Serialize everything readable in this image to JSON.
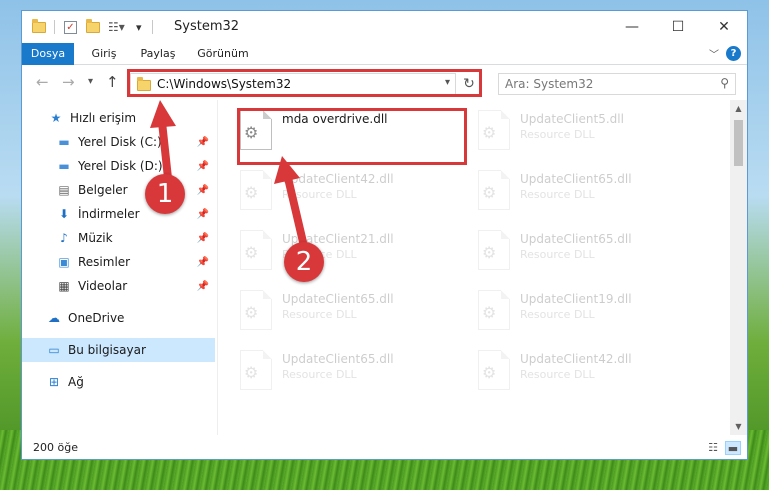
{
  "window": {
    "title": "System32",
    "controls": {
      "minimize": "—",
      "maximize": "☐",
      "close": "✕"
    }
  },
  "ribbon": {
    "tabs": [
      "Dosya",
      "Giriş",
      "Paylaş",
      "Görünüm"
    ],
    "active_tab": "Dosya",
    "help": "?"
  },
  "navigation": {
    "address": "C:\\Windows\\System32",
    "search_placeholder": "Ara: System32"
  },
  "sidebar": {
    "items": [
      {
        "label": "Hızlı erişim",
        "icon": "star-icon"
      },
      {
        "label": "Yerel Disk (C:)",
        "icon": "drive-icon",
        "pinned": true
      },
      {
        "label": "Yerel Disk (D:)",
        "icon": "drive-icon",
        "pinned": true
      },
      {
        "label": "Belgeler",
        "icon": "documents-icon",
        "pinned": true
      },
      {
        "label": "İndirmeler",
        "icon": "download-icon",
        "pinned": true
      },
      {
        "label": "Müzik",
        "icon": "music-icon",
        "pinned": true
      },
      {
        "label": "Resimler",
        "icon": "pictures-icon",
        "pinned": true
      },
      {
        "label": "Videolar",
        "icon": "videos-icon",
        "pinned": true
      },
      {
        "label": "OneDrive",
        "icon": "cloud-icon"
      },
      {
        "label": "Bu bilgisayar",
        "icon": "computer-icon",
        "selected": true
      },
      {
        "label": "Ağ",
        "icon": "network-icon"
      }
    ]
  },
  "files": [
    {
      "name": "mda overdrive.dll",
      "type": "",
      "highlighted": true
    },
    {
      "name": "UpdateClient5.dll",
      "type": "Resource DLL"
    },
    {
      "name": "UpdateClient42.dll",
      "type": "Resource DLL"
    },
    {
      "name": "UpdateClient65.dll",
      "type": "Resource DLL"
    },
    {
      "name": "UpdateClient21.dll",
      "type": "Resource DLL"
    },
    {
      "name": "UpdateClient65.dll",
      "type": "Resource DLL"
    },
    {
      "name": "UpdateClient65.dll",
      "type": "Resource DLL"
    },
    {
      "name": "UpdateClient19.dll",
      "type": "Resource DLL"
    },
    {
      "name": "UpdateClient65.dll",
      "type": "Resource DLL"
    },
    {
      "name": "UpdateClient42.dll",
      "type": "Resource DLL"
    }
  ],
  "status": {
    "item_count": "200 öğe"
  },
  "annotations": {
    "step1": "1",
    "step2": "2",
    "color": "#d8383a"
  }
}
